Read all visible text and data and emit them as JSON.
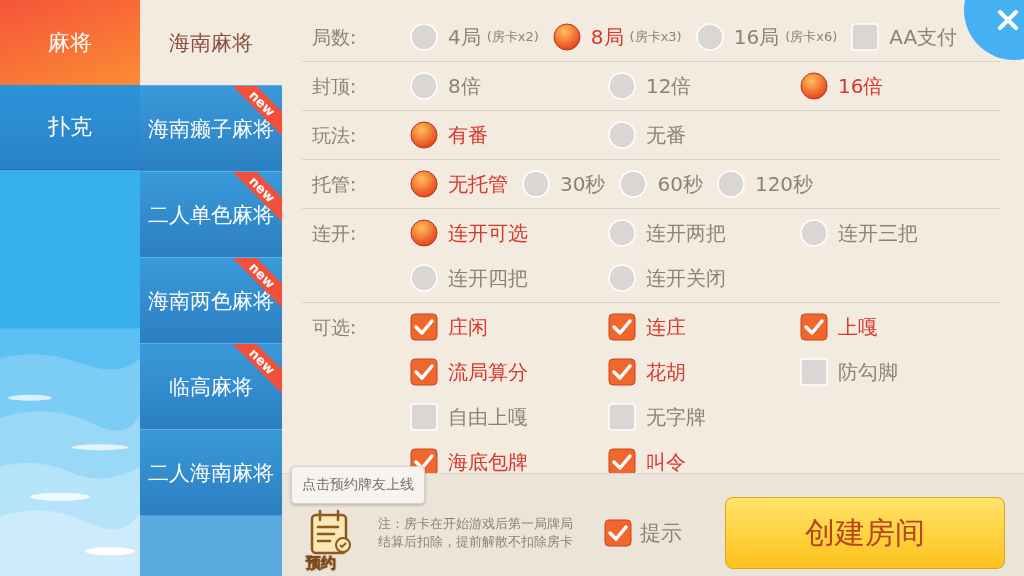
{
  "categories": [
    {
      "label": "麻将",
      "selected": true
    },
    {
      "label": "扑克",
      "selected": false
    }
  ],
  "games": [
    {
      "label": "海南麻将",
      "selected": true
    },
    {
      "label": "海南癞子麻将",
      "selected": false,
      "badge": "new"
    },
    {
      "label": "二人单色麻将",
      "selected": false,
      "badge": "new"
    },
    {
      "label": "海南两色麻将",
      "selected": false,
      "badge": "new"
    },
    {
      "label": "临高麻将",
      "selected": false,
      "badge": "new"
    },
    {
      "label": "二人海南麻将",
      "selected": false
    }
  ],
  "rules": [
    {
      "label": "局数:",
      "kind": "compact",
      "options": [
        {
          "kind": "radio",
          "label": "4局",
          "note": "(房卡x2)",
          "selected": false
        },
        {
          "kind": "radio",
          "label": "8局",
          "note": "(房卡x3)",
          "selected": true
        },
        {
          "kind": "radio",
          "label": "16局",
          "note": "(房卡x6)",
          "selected": false
        },
        {
          "kind": "check",
          "label": "AA支付",
          "selected": false
        }
      ]
    },
    {
      "label": "封顶:",
      "kind": "grid",
      "options": [
        {
          "kind": "radio",
          "label": "8倍",
          "selected": false
        },
        {
          "kind": "radio",
          "label": "12倍",
          "selected": false
        },
        {
          "kind": "radio",
          "label": "16倍",
          "selected": true
        }
      ]
    },
    {
      "label": "玩法:",
      "kind": "grid",
      "options": [
        {
          "kind": "radio",
          "label": "有番",
          "selected": true
        },
        {
          "kind": "radio",
          "label": "无番",
          "selected": false
        }
      ]
    },
    {
      "label": "托管:",
      "kind": "compact",
      "options": [
        {
          "kind": "radio",
          "label": "无托管",
          "selected": true
        },
        {
          "kind": "radio",
          "label": "30秒",
          "selected": false
        },
        {
          "kind": "radio",
          "label": "60秒",
          "selected": false
        },
        {
          "kind": "radio",
          "label": "120秒",
          "selected": false
        }
      ]
    },
    {
      "label": "连开:",
      "kind": "grid",
      "options": [
        {
          "kind": "radio",
          "label": "连开可选",
          "selected": true
        },
        {
          "kind": "radio",
          "label": "连开两把",
          "selected": false
        },
        {
          "kind": "radio",
          "label": "连开三把",
          "selected": false
        },
        {
          "kind": "radio",
          "label": "连开四把",
          "selected": false
        },
        {
          "kind": "radio",
          "label": "连开关闭",
          "selected": false
        }
      ]
    },
    {
      "label": "可选:",
      "kind": "grid",
      "options": [
        {
          "kind": "check",
          "label": "庄闲",
          "selected": true
        },
        {
          "kind": "check",
          "label": "连庄",
          "selected": true
        },
        {
          "kind": "check",
          "label": "上嘎",
          "selected": true
        },
        {
          "kind": "check",
          "label": "流局算分",
          "selected": true
        },
        {
          "kind": "check",
          "label": "花胡",
          "selected": true
        },
        {
          "kind": "check",
          "label": "防勾脚",
          "selected": false
        },
        {
          "kind": "check",
          "label": "自由上嘎",
          "selected": false
        },
        {
          "kind": "check",
          "label": "无字牌",
          "selected": false
        },
        {
          "kind": "empty"
        },
        {
          "kind": "check",
          "label": "海底包牌",
          "selected": true
        },
        {
          "kind": "check",
          "label": "叫令",
          "selected": true
        }
      ]
    }
  ],
  "footer": {
    "tooltip": "点击预约牌友上线",
    "reserve_label": "预约",
    "note": "注：房卡在开始游戏后第一局牌局结算后扣除，提前解散不扣除房卡",
    "hint": {
      "label": "提示",
      "checked": true
    },
    "create_button": "创建房间"
  }
}
